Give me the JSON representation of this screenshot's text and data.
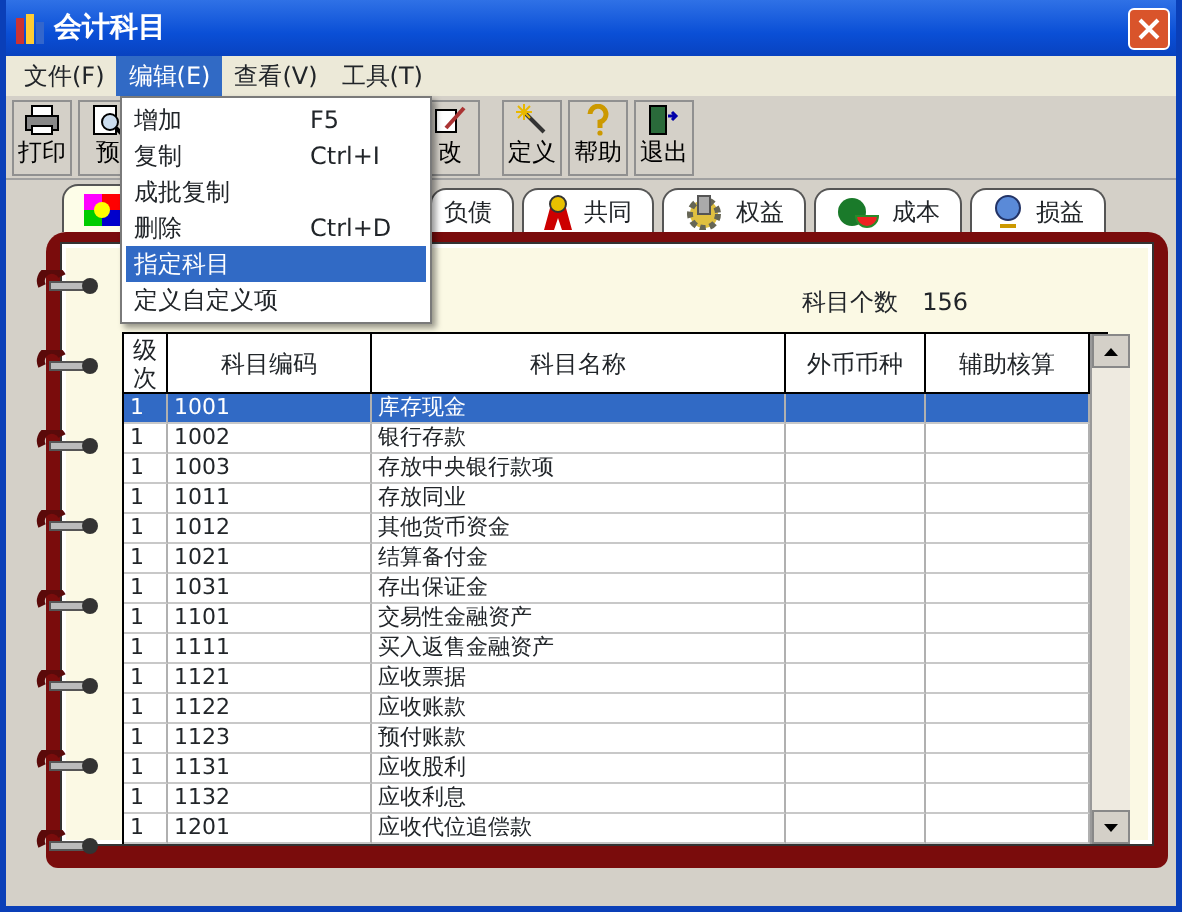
{
  "window": {
    "title": "会计科目"
  },
  "menu_bar": [
    {
      "label": "文件(F)",
      "selected": false
    },
    {
      "label": "编辑(E)",
      "selected": true
    },
    {
      "label": "查看(V)",
      "selected": false
    },
    {
      "label": "工具(T)",
      "selected": false
    }
  ],
  "dropdown_menu": [
    {
      "label": "增加",
      "shortcut": "F5",
      "selected": false
    },
    {
      "label": "复制",
      "shortcut": "Ctrl+I",
      "selected": false
    },
    {
      "label": "成批复制",
      "selected": false
    },
    {
      "label": "删除",
      "shortcut": "Ctrl+D",
      "selected": false
    },
    {
      "label": "指定科目",
      "selected": true
    },
    {
      "label": "定义自定义项",
      "selected": false
    }
  ],
  "toolbar": [
    {
      "label": "打印",
      "kind": "print"
    },
    {
      "label": "预",
      "kind": "preview"
    },
    {
      "label": "改",
      "kind": "edit"
    },
    {
      "label": "定义",
      "kind": "wand"
    },
    {
      "label": "帮助",
      "kind": "help"
    },
    {
      "label": "退出",
      "kind": "exit"
    }
  ],
  "tabs": [
    {
      "kind": "colors",
      "selected": true
    },
    {
      "label": "负债",
      "kind": "none",
      "selected": false
    },
    {
      "label": "共同",
      "kind": "ribbon",
      "selected": false
    },
    {
      "label": "权益",
      "kind": "gear",
      "selected": false
    },
    {
      "label": "成本",
      "kind": "melon",
      "selected": false
    },
    {
      "label": "损益",
      "kind": "globe",
      "selected": false
    }
  ],
  "account_count": {
    "label": "科目个数",
    "value": "156"
  },
  "table": {
    "columns": [
      "级次",
      "科目编码",
      "科目名称",
      "外币币种",
      "辅助核算"
    ],
    "rows": [
      {
        "cells": [
          "1",
          "1001",
          "库存现金"
        ],
        "selected": true
      },
      {
        "cells": [
          "1",
          "1002",
          "银行存款"
        ],
        "selected": false
      },
      {
        "cells": [
          "1",
          "1003",
          "存放中央银行款项"
        ],
        "selected": false
      },
      {
        "cells": [
          "1",
          "1011",
          "存放同业"
        ],
        "selected": false
      },
      {
        "cells": [
          "1",
          "1012",
          "其他货币资金"
        ],
        "selected": false
      },
      {
        "cells": [
          "1",
          "1021",
          "结算备付金"
        ],
        "selected": false
      },
      {
        "cells": [
          "1",
          "1031",
          "存出保证金"
        ],
        "selected": false
      },
      {
        "cells": [
          "1",
          "1101",
          "交易性金融资产"
        ],
        "selected": false
      },
      {
        "cells": [
          "1",
          "1111",
          "买入返售金融资产"
        ],
        "selected": false
      },
      {
        "cells": [
          "1",
          "1121",
          "应收票据"
        ],
        "selected": false
      },
      {
        "cells": [
          "1",
          "1122",
          "应收账款"
        ],
        "selected": false
      },
      {
        "cells": [
          "1",
          "1123",
          "预付账款"
        ],
        "selected": false
      },
      {
        "cells": [
          "1",
          "1131",
          "应收股利"
        ],
        "selected": false
      },
      {
        "cells": [
          "1",
          "1132",
          "应收利息"
        ],
        "selected": false
      },
      {
        "cells": [
          "1",
          "1201",
          "应收代位追偿款"
        ],
        "selected": false
      }
    ]
  }
}
